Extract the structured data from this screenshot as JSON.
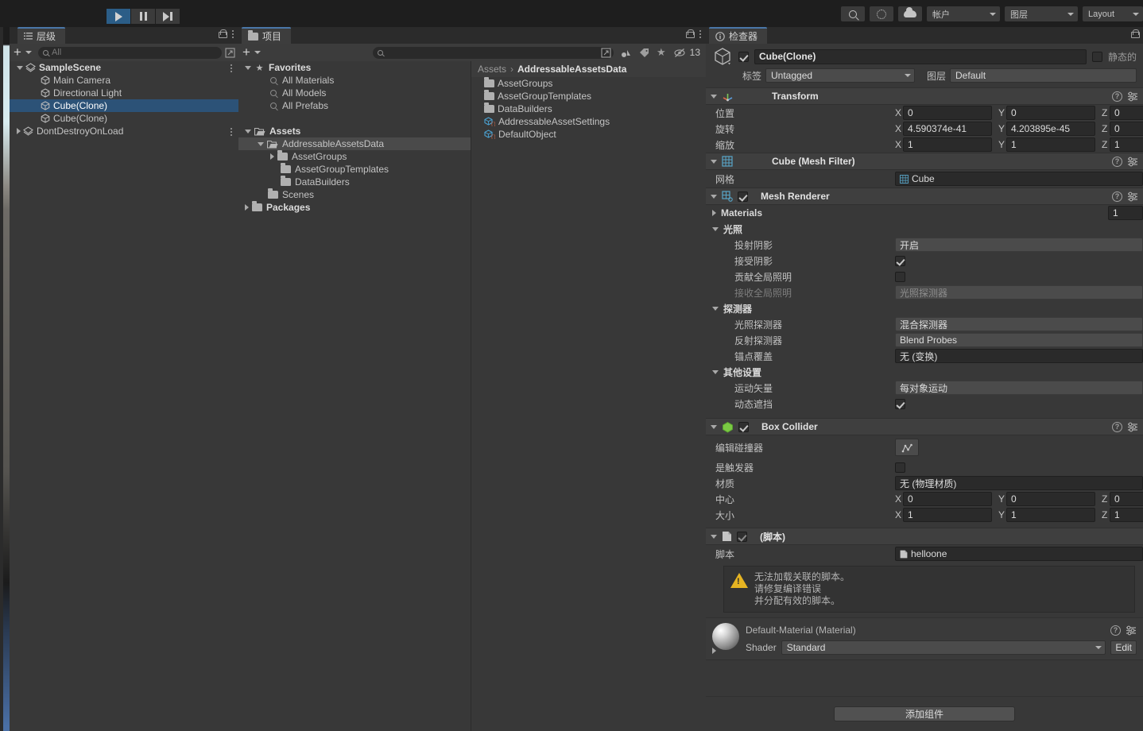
{
  "toolbar": {
    "play_label": "play-button",
    "pause_label": "pause-button",
    "step_label": "step-button",
    "search_icon": "search-icon",
    "lighting_icon": "lighting-icon",
    "cloud_icon": "cloud-icon",
    "account_label": "帐户",
    "layers_label": "图层",
    "layout_label": "Layout"
  },
  "hierarchy": {
    "tab_label": "层级",
    "search_placeholder": "All",
    "items": [
      {
        "label": "SampleScene",
        "icon": "scene-icon",
        "depth": 1,
        "expander": "down",
        "bold": true,
        "selected": false,
        "kebab": true
      },
      {
        "label": "Main Camera",
        "icon": "gameobject-icon",
        "depth": 2,
        "expander": "none",
        "bold": false,
        "selected": false,
        "kebab": false
      },
      {
        "label": "Directional Light",
        "icon": "gameobject-icon",
        "depth": 2,
        "expander": "none",
        "bold": false,
        "selected": false,
        "kebab": false
      },
      {
        "label": "Cube(Clone)",
        "icon": "gameobject-icon",
        "depth": 2,
        "expander": "none",
        "bold": false,
        "selected": true,
        "kebab": false
      },
      {
        "label": "Cube(Clone)",
        "icon": "gameobject-icon",
        "depth": 2,
        "expander": "none",
        "bold": false,
        "selected": false,
        "kebab": false
      },
      {
        "label": "DontDestroyOnLoad",
        "icon": "scene-icon",
        "depth": 1,
        "expander": "right",
        "bold": false,
        "selected": false,
        "kebab": true
      }
    ]
  },
  "project": {
    "tab_label": "项目",
    "search_placeholder": "",
    "hidden_count": "13",
    "tree": [
      {
        "label": "Favorites",
        "icon": "star-icon",
        "depth": 0,
        "expander": "down",
        "bold": true,
        "highlight": false
      },
      {
        "label": "All Materials",
        "icon": "search-icon",
        "depth": 1,
        "expander": "none",
        "bold": false,
        "highlight": false
      },
      {
        "label": "All Models",
        "icon": "search-icon",
        "depth": 1,
        "expander": "none",
        "bold": false,
        "highlight": false
      },
      {
        "label": "All Prefabs",
        "icon": "search-icon",
        "depth": 1,
        "expander": "none",
        "bold": false,
        "highlight": false
      },
      {
        "label": "",
        "icon": "none",
        "depth": 0,
        "expander": "none",
        "bold": false,
        "highlight": false
      },
      {
        "label": "Assets",
        "icon": "folder-open-icon",
        "depth": 0,
        "expander": "down",
        "bold": true,
        "highlight": false
      },
      {
        "label": "AddressableAssetsData",
        "icon": "folder-open-icon",
        "depth": 1,
        "expander": "down",
        "bold": false,
        "highlight": true
      },
      {
        "label": "AssetGroups",
        "icon": "folder-icon",
        "depth": 2,
        "expander": "right",
        "bold": false,
        "highlight": false
      },
      {
        "label": "AssetGroupTemplates",
        "icon": "folder-icon",
        "depth": 2,
        "expander": "none",
        "bold": false,
        "highlight": false
      },
      {
        "label": "DataBuilders",
        "icon": "folder-icon",
        "depth": 2,
        "expander": "none",
        "bold": false,
        "highlight": false
      },
      {
        "label": "Scenes",
        "icon": "folder-icon",
        "depth": 1,
        "expander": "none",
        "bold": false,
        "highlight": false
      },
      {
        "label": "Packages",
        "icon": "folder-icon",
        "depth": 0,
        "expander": "right",
        "bold": true,
        "highlight": false
      }
    ],
    "breadcrumb": {
      "root": "Assets",
      "separator": "›",
      "current": "AddressableAssetsData"
    },
    "contents": [
      {
        "label": "AssetGroups",
        "icon": "folder-icon"
      },
      {
        "label": "AssetGroupTemplates",
        "icon": "folder-icon"
      },
      {
        "label": "DataBuilders",
        "icon": "folder-icon"
      },
      {
        "label": "AddressableAssetSettings",
        "icon": "scriptableobject-icon"
      },
      {
        "label": "DefaultObject",
        "icon": "scriptableobject-icon"
      }
    ]
  },
  "inspector": {
    "tab_label": "检查器",
    "object_name": "Cube(Clone)",
    "object_enabled": true,
    "static_label": "静态的",
    "static_checked": false,
    "tag_label": "标签",
    "tag_value": "Untagged",
    "layer_label": "图层",
    "layer_value": "Default",
    "transform": {
      "title": "Transform",
      "rows": [
        {
          "name": "位置",
          "x": "0",
          "y": "0",
          "z": "0"
        },
        {
          "name": "旋转",
          "x": "4.590374e-41",
          "y": "4.203895e-45",
          "z": "0"
        },
        {
          "name": "缩放",
          "x": "1",
          "y": "1",
          "z": "1"
        }
      ]
    },
    "mesh_filter": {
      "title": "Cube (Mesh Filter)",
      "mesh_label": "网格",
      "mesh_value": "Cube"
    },
    "mesh_renderer": {
      "title": "Mesh Renderer",
      "enabled": true,
      "materials_label": "Materials",
      "materials_count": "1",
      "lighting_label": "光照",
      "cast_shadows_label": "投射阴影",
      "cast_shadows_value": "开启",
      "receive_shadows_label": "接受阴影",
      "receive_shadows_checked": true,
      "contribute_gi_label": "贡献全局照明",
      "contribute_gi_checked": false,
      "receive_gi_label": "接收全局照明",
      "receive_gi_value": "光照探测器",
      "probes_label": "探测器",
      "light_probes_label": "光照探测器",
      "light_probes_value": "混合探测器",
      "reflection_probes_label": "反射探测器",
      "reflection_probes_value": "Blend Probes",
      "anchor_override_label": "锚点覆盖",
      "anchor_override_value": "无 (变换)",
      "other_label": "其他设置",
      "motion_vectors_label": "运动矢量",
      "motion_vectors_value": "每对象运动",
      "dynamic_occlusion_label": "动态遮挡",
      "dynamic_occlusion_checked": true
    },
    "box_collider": {
      "title": "Box Collider",
      "enabled": true,
      "edit_collider_label": "编辑碰撞器",
      "is_trigger_label": "是触发器",
      "is_trigger_checked": false,
      "material_label": "材质",
      "material_value": "无 (物理材质)",
      "center_label": "中心",
      "center": {
        "x": "0",
        "y": "0",
        "z": "0"
      },
      "size_label": "大小",
      "size": {
        "x": "1",
        "y": "1",
        "z": "1"
      }
    },
    "script_component": {
      "title": "(脚本)",
      "enabled": true,
      "script_label": "脚本",
      "script_value": "helloone",
      "warning_lines": [
        "无法加载关联的脚本。",
        "请修复编译错误",
        "并分配有效的脚本。"
      ]
    },
    "material_preview": {
      "title": "Default-Material (Material)",
      "shader_label": "Shader",
      "shader_value": "Standard",
      "edit_label": "Edit"
    },
    "add_component_label": "添加组件"
  },
  "colors": {
    "accent_blue": "#2b5d87",
    "selection_blue": "#2c5277",
    "panel_bg": "#383838",
    "toolbar_bg": "#1e1e1e",
    "warn_yellow": "#e6b422"
  }
}
